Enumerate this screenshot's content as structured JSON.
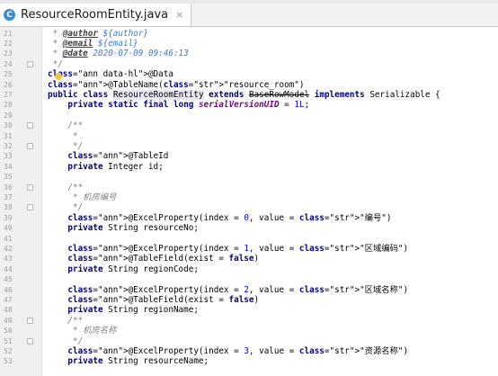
{
  "tab": {
    "icon_letter": "C",
    "title": "ResourceRoomEntity.java",
    "close_glyph": "×"
  },
  "lines": [
    {
      "n": "21",
      "t": " * @author ${author}"
    },
    {
      "n": "22",
      "t": " * @email ${email}"
    },
    {
      "n": "23",
      "t": " * @date 2020-07-09 09:46:13"
    },
    {
      "n": "24",
      "t": " */"
    },
    {
      "n": "25",
      "t": "@Data"
    },
    {
      "n": "26",
      "t": "@TableName(\"resource_room\")"
    },
    {
      "n": "27",
      "t": "public class ResourceRoomEntity extends BaseRowModel implements Serializable {"
    },
    {
      "n": "28",
      "t": "    private static final long serialVersionUID = 1L;"
    },
    {
      "n": "29",
      "t": ""
    },
    {
      "n": "30",
      "t": "    /**"
    },
    {
      "n": "31",
      "t": "     *"
    },
    {
      "n": "32",
      "t": "     */"
    },
    {
      "n": "33",
      "t": "    @TableId"
    },
    {
      "n": "34",
      "t": "    private Integer id;"
    },
    {
      "n": "35",
      "t": ""
    },
    {
      "n": "36",
      "t": "    /**"
    },
    {
      "n": "37",
      "t": "     * 机房编号"
    },
    {
      "n": "38",
      "t": "     */"
    },
    {
      "n": "39",
      "t": "    @ExcelProperty(index = 0, value = \"编号\")"
    },
    {
      "n": "40",
      "t": "    private String resourceNo;"
    },
    {
      "n": "41",
      "t": ""
    },
    {
      "n": "42",
      "t": "    @ExcelProperty(index = 1, value = \"区域编码\")"
    },
    {
      "n": "43",
      "t": "    @TableField(exist = false)"
    },
    {
      "n": "44",
      "t": "    private String regionCode;"
    },
    {
      "n": "45",
      "t": ""
    },
    {
      "n": "46",
      "t": "    @ExcelProperty(index = 2, value = \"区域名称\")"
    },
    {
      "n": "47",
      "t": "    @TableField(exist = false)"
    },
    {
      "n": "48",
      "t": "    private String regionName;"
    },
    {
      "n": "49",
      "t": "    /**"
    },
    {
      "n": "50",
      "t": "     * 机房名称"
    },
    {
      "n": "51",
      "t": "     */"
    },
    {
      "n": "52",
      "t": "    @ExcelProperty(index = 3, value = \"资源名称\")"
    },
    {
      "n": "53",
      "t": "    private String resourceName;"
    }
  ]
}
